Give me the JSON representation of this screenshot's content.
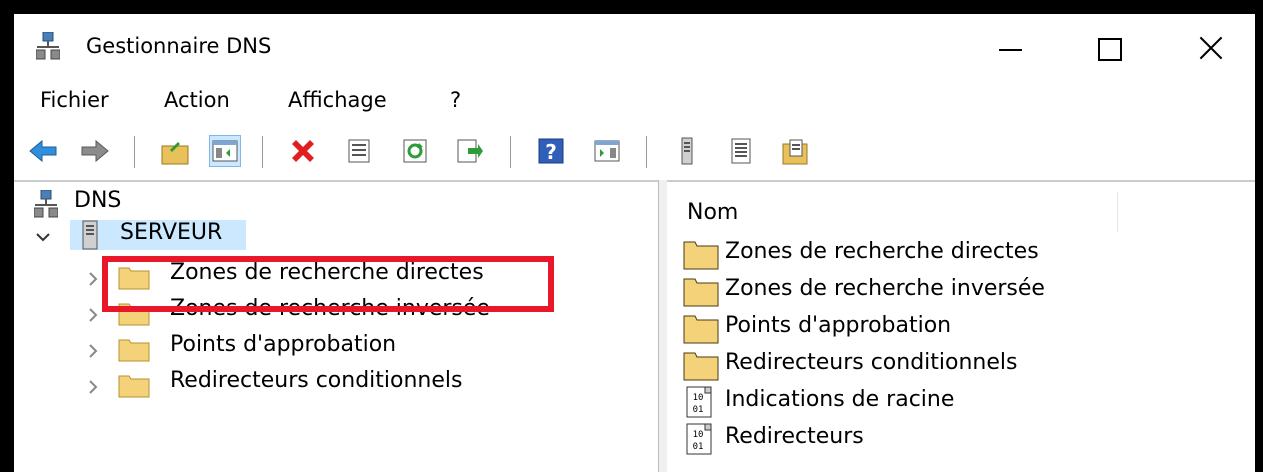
{
  "window": {
    "title": "Gestionnaire DNS",
    "controls": {
      "minimize": "minimize-icon",
      "maximize": "maximize-icon",
      "close": "close-icon"
    }
  },
  "menu": [
    "Fichier",
    "Action",
    "Affichage",
    "?"
  ],
  "toolbar": {
    "icons": [
      "back-arrow-icon",
      "forward-arrow-icon",
      "up-folder-icon",
      "show-hide-console-tree-icon",
      "delete-icon",
      "properties-icon",
      "refresh-icon",
      "export-list-icon",
      "help-icon",
      "action-pane-icon",
      "server-icon",
      "list-view-icon",
      "zone-icon"
    ]
  },
  "tree": {
    "root": "DNS",
    "server": "SERVEUR",
    "children": [
      "Zones de recherche directes",
      "Zones de recherche inversée",
      "Points d'approbation",
      "Redirecteurs conditionnels"
    ]
  },
  "list": {
    "column_header": "Nom",
    "items": [
      {
        "label": "Zones de recherche directes",
        "icon": "folder-icon"
      },
      {
        "label": "Zones de recherche inversée",
        "icon": "folder-icon"
      },
      {
        "label": "Points d'approbation",
        "icon": "folder-icon"
      },
      {
        "label": "Redirecteurs conditionnels",
        "icon": "folder-icon"
      },
      {
        "label": "Indications de racine",
        "icon": "binary-file-icon"
      },
      {
        "label": "Redirecteurs",
        "icon": "binary-file-icon"
      }
    ]
  },
  "colors": {
    "selection": "#cce8ff",
    "highlight_border": "#e8172a",
    "folder": "#e8c15a"
  }
}
